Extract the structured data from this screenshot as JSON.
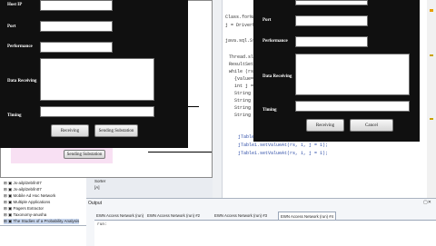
{
  "left_dialog": {
    "labels": {
      "host_ip": "Host IP",
      "port": "Port",
      "performance": "Performance",
      "data_receiving": "Data Receiving",
      "timing": "Timing"
    },
    "buttons": {
      "receiving": "Receiving",
      "sending_substation": "Sending Substation"
    }
  },
  "background_window": {
    "button": "Sending Substation"
  },
  "right_dialog": {
    "labels": {
      "port": "Port",
      "performance": "Performance",
      "data_receiving": "Data Receiving",
      "timing": "Timing"
    },
    "buttons": {
      "receiving": "Receiving",
      "cancel": "Cancel"
    }
  },
  "editor": {
    "lines": [
      "Class.forNa",
      "j = DriverM",
      "",
      "java.sql.St",
      "",
      "Thread.sle",
      "ResultSet r",
      "while (rs.n",
      "{value=",
      "int j =",
      "String",
      "String",
      "String",
      "String"
    ],
    "lines_lower": [
      "jTable1.",
      "jTable1.setValueAt(rs, i, j = 1);",
      "jTable1.setValueAt(rs, i, j = 1);"
    ]
  },
  "project_tree": {
    "items": [
      "Jx-ailpl2eb/ln07",
      "Jx-ailpl2eb/ln07",
      "Mobile Ad Hoc Network",
      "Multiple Applications",
      "Pagers Extractor",
      "Taxonomy-anusha",
      "The Studies of a Probability Analysis"
    ]
  },
  "side_labels": {
    "sorter": "Sorter",
    "list": "[A]"
  },
  "output": {
    "title": "Output",
    "tabs": [
      "EWN Access Network (run)",
      "EWN Access Network (run) #2",
      "EWN Access Network (run) #3",
      "EWN Access Network (run) #4"
    ],
    "console_text": "run:"
  }
}
